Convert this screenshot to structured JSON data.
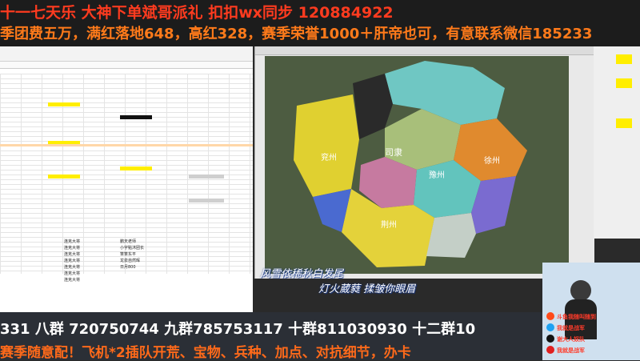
{
  "ticker": {
    "line1": "十一七天乐 大神下单斌哥派礼 扣扣wx同步 120884922",
    "line2": "季团费五万，满红落地648，高红328，赛季荣誉1000＋肝帝也可，有意联系微信185233"
  },
  "spreadsheet": {
    "notes": [
      "连克大将",
      "连克大将",
      "连克大将",
      "连克大将",
      "连克大将",
      "连克大将",
      "连克大将"
    ],
    "notes2": [
      "鹏天老师",
      "小字點沐团长",
      "笨笨东平",
      "龙泉自然晖",
      "日月800"
    ]
  },
  "map": {
    "labels": [
      "兖州",
      "司隶",
      "豫州",
      "荆州",
      "徐州"
    ]
  },
  "lyrics": {
    "line1": "风雪依稀秋白发尾",
    "line2": "灯火葳蕤 揉皱你眼眉"
  },
  "groups": {
    "text": "331 八群 720750744 九群785753117   十群811030930 十二群10"
  },
  "promo": {
    "text": "赛季随意配！飞机*2插队开荒、宝物、兵种、加点、对抗细节，办卡"
  },
  "webcam": {
    "tags": [
      "斗鱼我随叫随到",
      "我就是战军",
      "谢大人奴队",
      "我就是战军"
    ]
  },
  "colors": {
    "ticker_red": "#ff3b1f",
    "ticker_orange": "#ff7a1a",
    "highlight_yellow": "#ffee00"
  }
}
